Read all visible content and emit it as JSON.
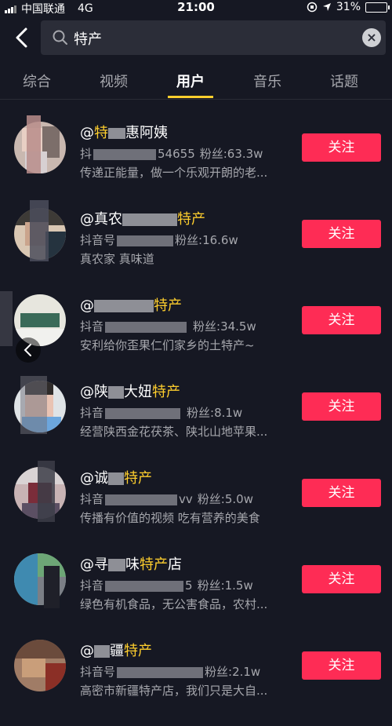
{
  "status_bar": {
    "carrier": "中国联通",
    "network": "4G",
    "time": "21:00",
    "battery": "31%"
  },
  "search": {
    "query": "特产",
    "back_icon": "chevron-left-icon",
    "search_icon": "search-icon",
    "clear_icon": "clear-icon"
  },
  "tabs": [
    {
      "label": "综合"
    },
    {
      "label": "视频"
    },
    {
      "label": "用户",
      "active": true
    },
    {
      "label": "音乐"
    },
    {
      "label": "话题"
    }
  ],
  "colors": {
    "background": "#161823",
    "accent_yellow": "#fece2d",
    "follow_red": "#fe2c55",
    "secondary_text": "#a6a7ad"
  },
  "users": [
    {
      "name_prefix": "@",
      "name_a": "特",
      "name_b": "",
      "name_hl": "",
      "name_c": "惠阿姨",
      "id_prefix": "抖",
      "id_suffix": "54655",
      "fans": "粉丝:63.3w",
      "desc": "传递正能量，做一个乐观开朗的老...",
      "follow": "关注"
    },
    {
      "name_prefix": "@",
      "name_a": "真农",
      "name_b": "",
      "name_hl": "特产",
      "name_c": "",
      "id_prefix": "抖音号",
      "id_suffix": "",
      "fans": "粉丝:16.6w",
      "desc": "真农家 真味道",
      "follow": "关注"
    },
    {
      "name_prefix": "@",
      "name_a": "",
      "name_b": "",
      "name_hl": "特产",
      "name_c": "",
      "id_prefix": "抖音",
      "id_suffix": "",
      "fans": "粉丝:34.5w",
      "desc": "安利给你歪果仁们家乡的土特产~",
      "follow": "关注"
    },
    {
      "name_prefix": "@",
      "name_a": "陕",
      "name_b": "大妞",
      "name_hl": "特产",
      "name_c": "",
      "id_prefix": "抖音",
      "id_suffix": "",
      "fans": "粉丝:8.1w",
      "desc": "经营陕西金花茯茶、陕北山地苹果...",
      "follow": "关注"
    },
    {
      "name_prefix": "@",
      "name_a": "诚",
      "name_b": "",
      "name_hl": "特产",
      "name_c": "",
      "id_prefix": "抖音",
      "id_suffix": "vv",
      "fans": "粉丝:5.0w",
      "desc": "传播有价值的视频 吃有营养的美食",
      "follow": "关注"
    },
    {
      "name_prefix": "@",
      "name_a": "寻",
      "name_b": "味",
      "name_hl": "特产",
      "name_c": "店",
      "id_prefix": "抖音",
      "id_suffix": "5",
      "fans": "粉丝:1.5w",
      "desc": "绿色有机食品，无公害食品，农村...",
      "follow": "关注"
    },
    {
      "name_prefix": "@",
      "name_a": "",
      "name_b": "疆",
      "name_hl": "特产",
      "name_c": "",
      "id_prefix": "抖音号",
      "id_suffix": "",
      "fans": "粉丝:2.1w",
      "desc": "高密市新疆特产店，我们只是大自...",
      "follow": "关注"
    }
  ]
}
